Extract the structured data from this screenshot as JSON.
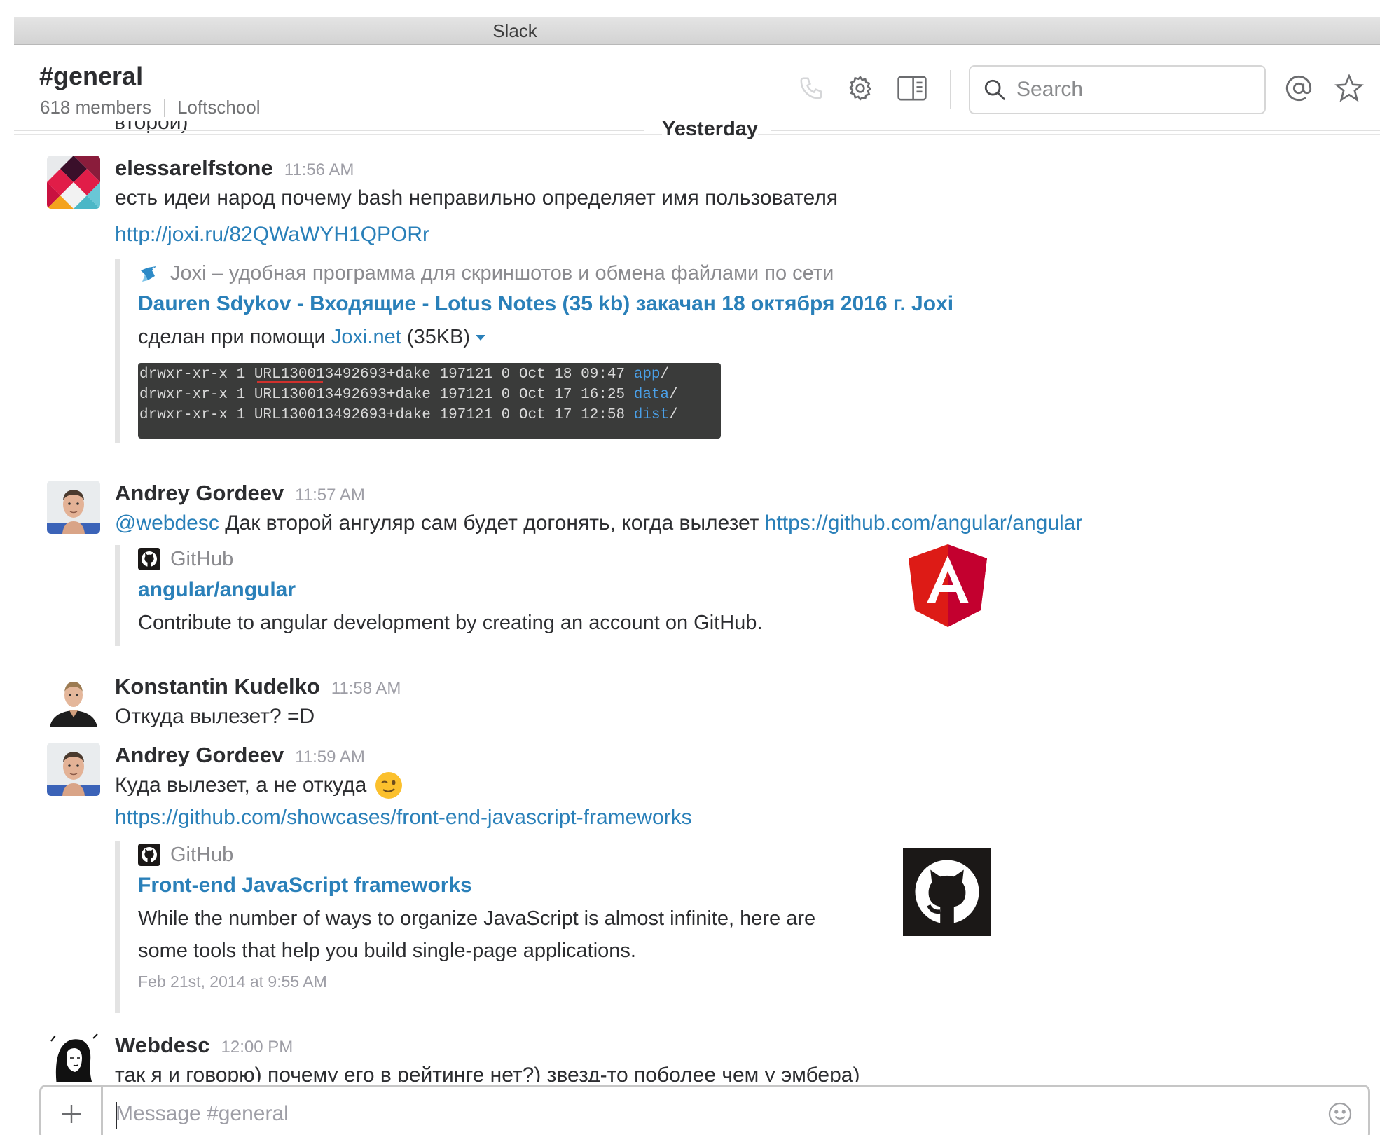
{
  "window": {
    "title": "Slack"
  },
  "header": {
    "channel": "#general",
    "members": "618 members",
    "team": "Loftschool",
    "search_placeholder": "Search"
  },
  "divider": {
    "date": "Yesterday",
    "cut_text": "второй)"
  },
  "messages": [
    {
      "author": "elessarelfstone",
      "time": "11:56 AM",
      "text": "есть идеи народ почему bash неправильно определяет имя пользователя",
      "link": "http://joxi.ru/82QWaWYH1QPORr",
      "attachment": {
        "service": "Joxi – удобная программа для скриншотов и обмена файлами по сети",
        "title": "Dauren Sdykov - Входящие - Lotus Notes (35 kb) закачан 18 октября 2016 г. Joxi",
        "text_prefix": "сделан при помощи ",
        "text_link": "Joxi.net",
        "text_suffix": " (35KB)",
        "terminal": [
          {
            "main": "drwxr-xr-x 1 URL130013492693+dake 197121 0 Oct 18 09:47 ",
            "blue": "app",
            "end": "/"
          },
          {
            "main": "drwxr-xr-x 1 URL130013492693+dake 197121 0 Oct 17 16:25 ",
            "blue": "data",
            "end": "/"
          },
          {
            "main": "drwxr-xr-x 1 URL130013492693+dake 197121 0 Oct 17 12:58 ",
            "blue": "dist",
            "end": "/"
          }
        ]
      }
    },
    {
      "author": "Andrey Gordeev",
      "time": "11:57 AM",
      "mention": "@webdesc",
      "text": " Дак второй ангуляр сам будет догонять, когда вылезет ",
      "link": "https://github.com/angular/angular",
      "attachment": {
        "service": "GitHub",
        "title": "angular/angular",
        "text": "Contribute to angular development by creating an account on GitHub."
      }
    },
    {
      "author": "Konstantin Kudelko",
      "time": "11:58 AM",
      "text": "Откуда вылезет? =D"
    },
    {
      "author": "Andrey Gordeev",
      "time": "11:59 AM",
      "text": "Куда вылезет, а не откуда",
      "link": "https://github.com/showcases/front-end-javascript-frameworks",
      "attachment": {
        "service": "GitHub",
        "title": "Front-end JavaScript frameworks",
        "text_line1": "While the number of ways to organize JavaScript is almost infinite, here are",
        "text_line2": "some tools that help you build single-page applications.",
        "footer": "Feb 21st, 2014 at 9:55 AM"
      }
    },
    {
      "author": "Webdesc",
      "time": "12:00 PM",
      "text": "так я и говорю) почему его в рейтинге нет?) звезд-то поболее чем у эмбера)"
    }
  ],
  "composer": {
    "placeholder": "Message #general"
  },
  "colors": {
    "link": "#2a80b9",
    "angular_red": "#dd1b16",
    "github_black": "#1b1817"
  }
}
